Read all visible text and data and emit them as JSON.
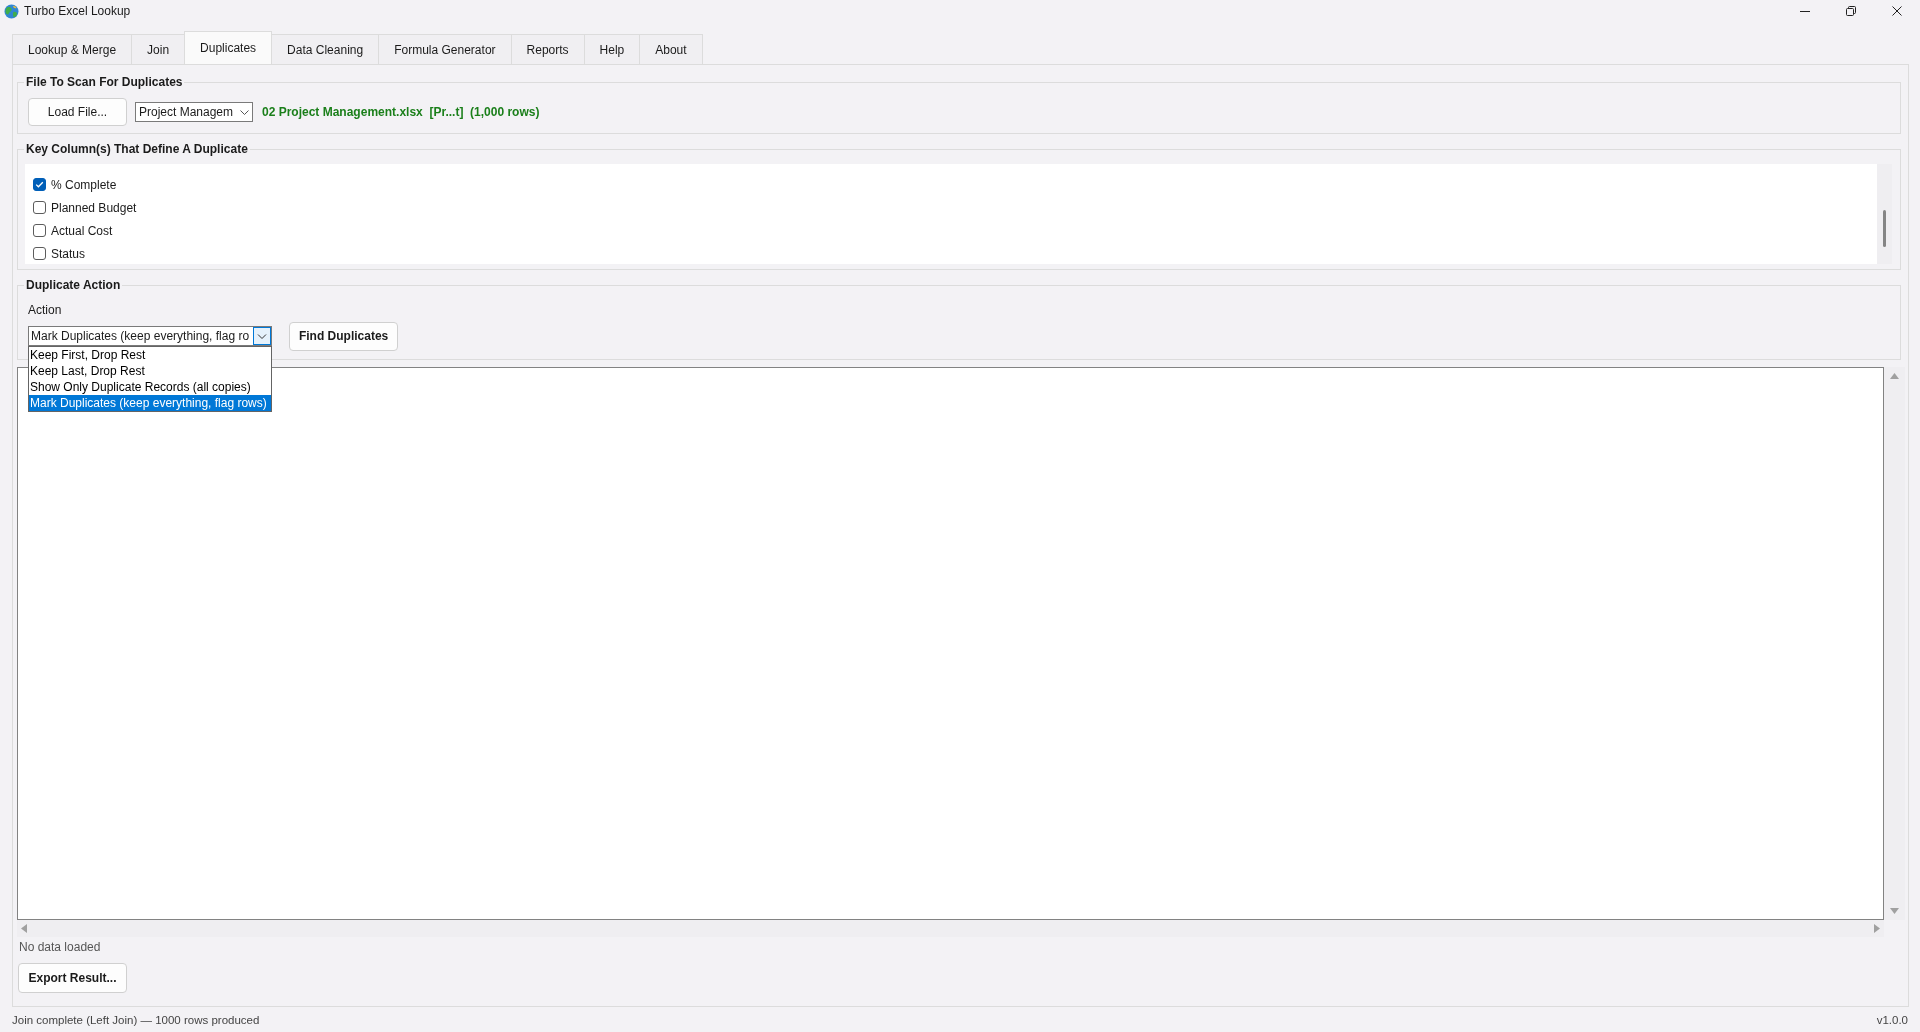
{
  "window": {
    "title": "Turbo Excel Lookup"
  },
  "tabs": [
    {
      "label": "Lookup & Merge",
      "selected": false
    },
    {
      "label": "Join",
      "selected": false
    },
    {
      "label": "Duplicates",
      "selected": true
    },
    {
      "label": "Data Cleaning",
      "selected": false
    },
    {
      "label": "Formula Generator",
      "selected": false
    },
    {
      "label": "Reports",
      "selected": false
    },
    {
      "label": "Help",
      "selected": false
    },
    {
      "label": "About",
      "selected": false
    }
  ],
  "file_section": {
    "title": "File To Scan For Duplicates",
    "load_button": "Load File...",
    "sheet_select": {
      "value": "Project Managem"
    },
    "file_info": "02 Project Management.xlsx  [Pr...t]  (1,000 rows)"
  },
  "key_columns": {
    "title": "Key Column(s) That Define A Duplicate",
    "columns": [
      {
        "label": "% Complete",
        "checked": true
      },
      {
        "label": "Planned Budget",
        "checked": false
      },
      {
        "label": "Actual Cost",
        "checked": false
      },
      {
        "label": "Status",
        "checked": false
      }
    ]
  },
  "duplicate_action": {
    "title": "Duplicate Action",
    "action_label": "Action",
    "action_select": {
      "value": "Mark Duplicates (keep everything, flag ro",
      "expanded": true,
      "options": [
        {
          "label": "Keep First, Drop Rest",
          "selected": false
        },
        {
          "label": "Keep Last, Drop Rest",
          "selected": false
        },
        {
          "label": "Show Only Duplicate Records (all copies)",
          "selected": false
        },
        {
          "label": "Mark Duplicates (keep everything, flag rows)",
          "selected": true
        }
      ]
    },
    "find_button": "Find Duplicates"
  },
  "results": {
    "message": "No data loaded",
    "export_button": "Export Result..."
  },
  "status_bar": {
    "message": "Join complete (Left Join) — 1000 rows produced",
    "version": "v1.0.0"
  }
}
